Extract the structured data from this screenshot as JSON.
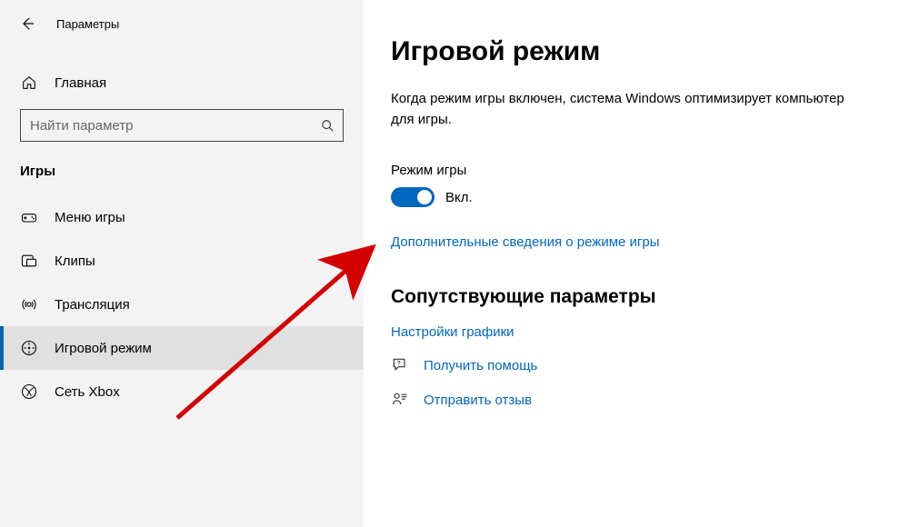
{
  "header": {
    "app_title": "Параметры"
  },
  "sidebar": {
    "home_label": "Главная",
    "search_placeholder": "Найти параметр",
    "category_label": "Игры",
    "items": [
      {
        "label": "Меню игры"
      },
      {
        "label": "Клипы"
      },
      {
        "label": "Трансляция"
      },
      {
        "label": "Игровой режим"
      },
      {
        "label": "Сеть Xbox"
      }
    ]
  },
  "main": {
    "title": "Игровой режим",
    "description": "Когда режим игры включен, система Windows оптимизирует компьютер для игры.",
    "setting_label": "Режим игры",
    "toggle_state_label": "Вкл.",
    "learn_more_link": "Дополнительные сведения о режиме игры",
    "related_header": "Сопутствующие параметры",
    "graphics_link": "Настройки графики",
    "help_link": "Получить помощь",
    "feedback_link": "Отправить отзыв"
  }
}
